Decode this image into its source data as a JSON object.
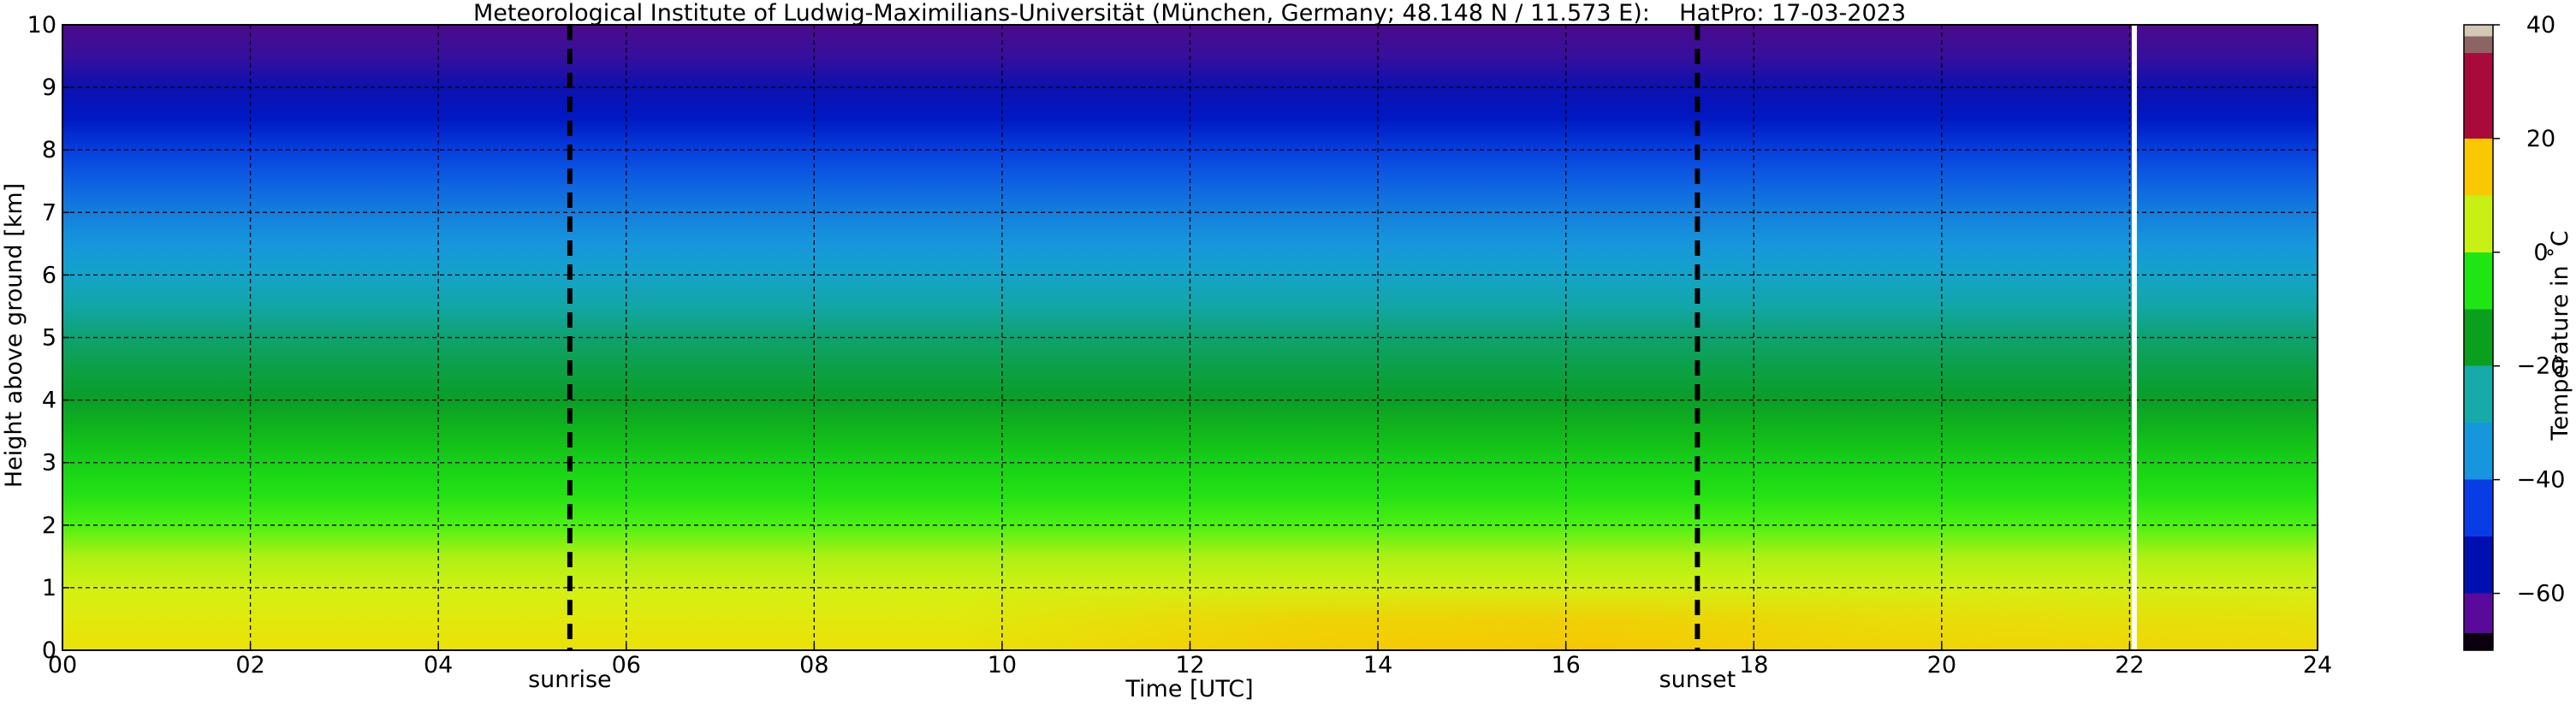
{
  "chart_data": {
    "type": "heatmap",
    "title": "Meteorological Institute of Ludwig-Maximilians-Universität (München, Germany; 48.148 N / 11.573 E):    HatPro: 17-03-2023",
    "xlabel": "Time [UTC]",
    "ylabel": "Height above ground [km]",
    "xlim": [
      0,
      24
    ],
    "ylim": [
      0,
      10
    ],
    "x_tick_labels": [
      "00",
      "02",
      "04",
      "06",
      "08",
      "10",
      "12",
      "14",
      "16",
      "18",
      "20",
      "22",
      "24"
    ],
    "y_tick_labels": [
      "0",
      "1",
      "2",
      "3",
      "4",
      "5",
      "6",
      "7",
      "8",
      "9",
      "10"
    ],
    "grid": true,
    "annotations": [
      {
        "label": "sunrise",
        "x": 5.4
      },
      {
        "label": "sunset",
        "x": 17.4
      }
    ],
    "data_gap_x": 22.05,
    "temperature_profile": {
      "heights_km": [
        0,
        0.5,
        1,
        1.5,
        2,
        2.5,
        3,
        3.5,
        4,
        4.5,
        5,
        5.5,
        6,
        6.5,
        7,
        7.5,
        8,
        8.5,
        9,
        9.5,
        10
      ],
      "temperatures_c": [
        10,
        8,
        5,
        2,
        -2,
        -6,
        -10,
        -14,
        -18,
        -21,
        -24,
        -28,
        -33,
        -37,
        -41,
        -45,
        -49,
        -55,
        -59,
        -63,
        -67
      ]
    },
    "afternoon_surface_warming_c": 6,
    "colorbar": {
      "label": "Temperature in ˚C",
      "vmin": -70,
      "vmax": 40,
      "tick_labels": [
        "40",
        "20",
        "0",
        "−20",
        "−40",
        "−60"
      ],
      "tick_values": [
        40,
        20,
        0,
        -20,
        -40,
        -60
      ],
      "colors": [
        {
          "from": -70,
          "to": -67,
          "color": "#0a0010"
        },
        {
          "from": -67,
          "to": -60,
          "color": "#5a0a9a"
        },
        {
          "from": -60,
          "to": -50,
          "color": "#0010b0"
        },
        {
          "from": -50,
          "to": -40,
          "color": "#0a3ce6"
        },
        {
          "from": -40,
          "to": -30,
          "color": "#1696dc"
        },
        {
          "from": -30,
          "to": -20,
          "color": "#16aaaa"
        },
        {
          "from": -20,
          "to": -10,
          "color": "#0aa01e"
        },
        {
          "from": -10,
          "to": 0,
          "color": "#1ee614"
        },
        {
          "from": 0,
          "to": 10,
          "color": "#c8f014"
        },
        {
          "from": 10,
          "to": 20,
          "color": "#fac800"
        },
        {
          "from": 20,
          "to": 35,
          "color": "#a80a3c"
        },
        {
          "from": 35,
          "to": 38,
          "color": "#8c6464"
        },
        {
          "from": 38,
          "to": 40,
          "color": "#d2c8b4"
        }
      ],
      "gradient_stops": [
        {
          "t": -70,
          "color": "#0a0010"
        },
        {
          "t": -67,
          "color": "#4b0a8c"
        },
        {
          "t": -62,
          "color": "#3210a0"
        },
        {
          "t": -58,
          "color": "#0010b4"
        },
        {
          "t": -52,
          "color": "#0022d2"
        },
        {
          "t": -47,
          "color": "#0a50e6"
        },
        {
          "t": -42,
          "color": "#1478dc"
        },
        {
          "t": -37,
          "color": "#1696dc"
        },
        {
          "t": -32,
          "color": "#14a6c4"
        },
        {
          "t": -27,
          "color": "#12a6a0"
        },
        {
          "t": -22,
          "color": "#0ca050"
        },
        {
          "t": -17,
          "color": "#0a9e1e"
        },
        {
          "t": -12,
          "color": "#14c819"
        },
        {
          "t": -7,
          "color": "#1edc14"
        },
        {
          "t": -3,
          "color": "#32f014"
        },
        {
          "t": 1,
          "color": "#a0f014"
        },
        {
          "t": 5,
          "color": "#d2f014"
        },
        {
          "t": 9,
          "color": "#e6e60a"
        },
        {
          "t": 13,
          "color": "#fad200"
        },
        {
          "t": 20,
          "color": "#fac000"
        }
      ]
    }
  }
}
